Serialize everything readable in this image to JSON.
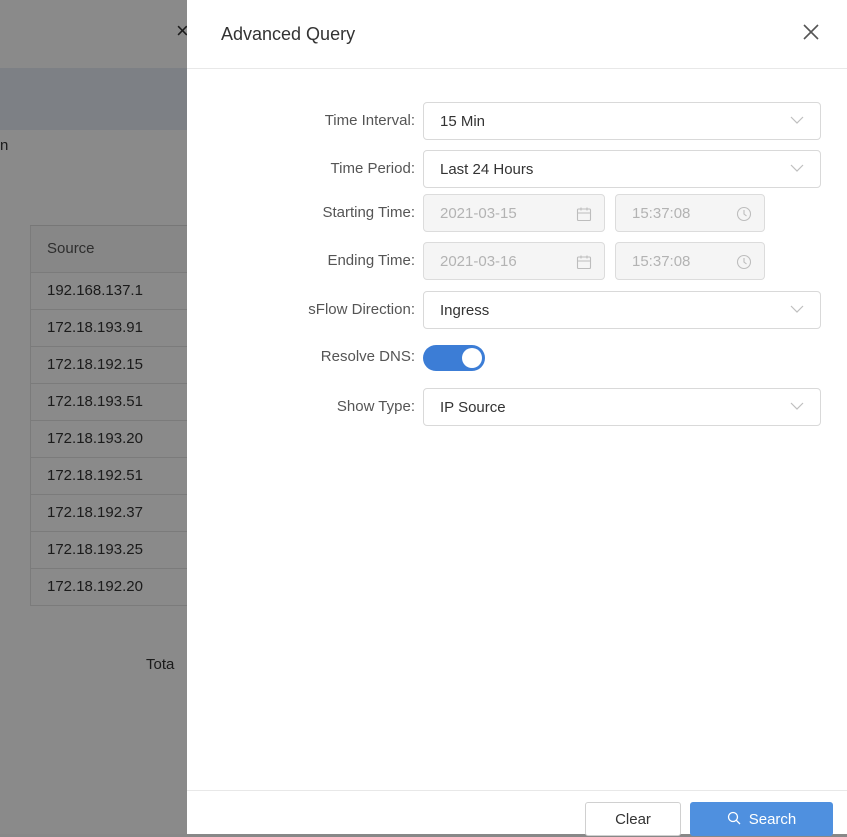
{
  "background": {
    "truncated_header_text": "n",
    "table": {
      "header": "Source",
      "rows": [
        "192.168.137.1",
        "172.18.193.91",
        "172.18.192.15",
        "172.18.193.51",
        "172.18.193.20",
        "172.18.192.51",
        "172.18.192.37",
        "172.18.193.25",
        "172.18.192.20"
      ]
    },
    "total_label": "Tota"
  },
  "drawer": {
    "title": "Advanced Query",
    "fields": {
      "time_interval": {
        "label": "Time Interval:",
        "value": "15 Min"
      },
      "time_period": {
        "label": "Time Period:",
        "value": "Last 24 Hours"
      },
      "starting_time": {
        "label": "Starting Time:",
        "date": "2021-03-15",
        "time": "15:37:08"
      },
      "ending_time": {
        "label": "Ending Time:",
        "date": "2021-03-16",
        "time": "15:37:08"
      },
      "sflow_direction": {
        "label": "sFlow Direction:",
        "value": "Ingress"
      },
      "resolve_dns": {
        "label": "Resolve DNS:",
        "enabled": true
      },
      "show_type": {
        "label": "Show Type:",
        "value": "IP Source"
      }
    },
    "footer": {
      "clear_label": "Clear",
      "search_label": "Search"
    }
  },
  "colors": {
    "primary": "#4f90df",
    "toggle_on": "#3c7dd6"
  }
}
